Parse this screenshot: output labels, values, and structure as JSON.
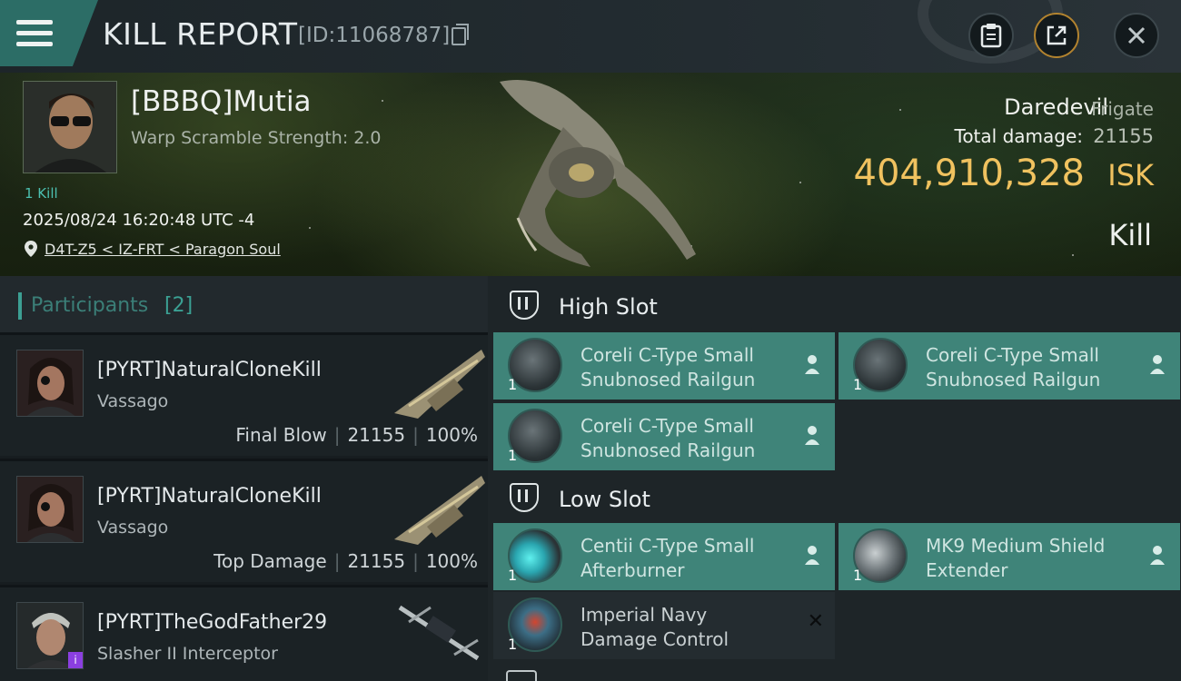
{
  "header": {
    "title": "KILL REPORT",
    "report_id": "[ID:11068787]",
    "icons": [
      "menu-icon",
      "copy-icon",
      "clipboard-icon",
      "share-icon",
      "close-icon"
    ]
  },
  "victim": {
    "name": "[BBBQ]Mutia",
    "warp_scramble": "Warp Scramble Strength: 2.0",
    "kills_link": "1 Kill",
    "datetime": "2025/08/24 16:20:48 UTC -4",
    "location": "D4T-Z5 < IZ-FRT < Paragon Soul",
    "ship_name": "Daredevil",
    "ship_class": "Frigate",
    "total_damage_label": "Total damage:",
    "total_damage": "21155",
    "isk_value": "404,910,328",
    "isk_unit": "ISK",
    "result": "Kill"
  },
  "participants": {
    "title": "Participants",
    "count": "[2]",
    "rows": [
      {
        "name": "[PYRT]NaturalCloneKill",
        "ship": "Vassago",
        "role": "Final Blow",
        "damage": "21155",
        "percent": "100%"
      },
      {
        "name": "[PYRT]NaturalCloneKill",
        "ship": "Vassago",
        "role": "Top Damage",
        "damage": "21155",
        "percent": "100%"
      },
      {
        "name": "[PYRT]TheGodFather29",
        "ship": "Slasher II Interceptor"
      }
    ],
    "insignia": "i"
  },
  "fitting": {
    "high_slot": {
      "title": "High Slot",
      "modules": [
        {
          "qty": "1",
          "name": "Coreli C-Type Small Snubnosed Railgun"
        },
        {
          "qty": "1",
          "name": "Coreli C-Type Small Snubnosed Railgun"
        },
        {
          "qty": "1",
          "name": "Coreli C-Type Small Snubnosed Railgun"
        }
      ]
    },
    "low_slot": {
      "title": "Low Slot",
      "modules": [
        {
          "qty": "1",
          "name": "Centii C-Type Small Afterburner"
        },
        {
          "qty": "1",
          "name": "MK9 Medium Shield Extender"
        },
        {
          "qty": "1",
          "name": "Imperial Navy Damage Control"
        }
      ]
    },
    "dropped_mark": "✕"
  },
  "colors": {
    "accent_teal": "#3f8479",
    "isk_gold": "#f0c25f",
    "menu_tab": "#2c6d66"
  }
}
